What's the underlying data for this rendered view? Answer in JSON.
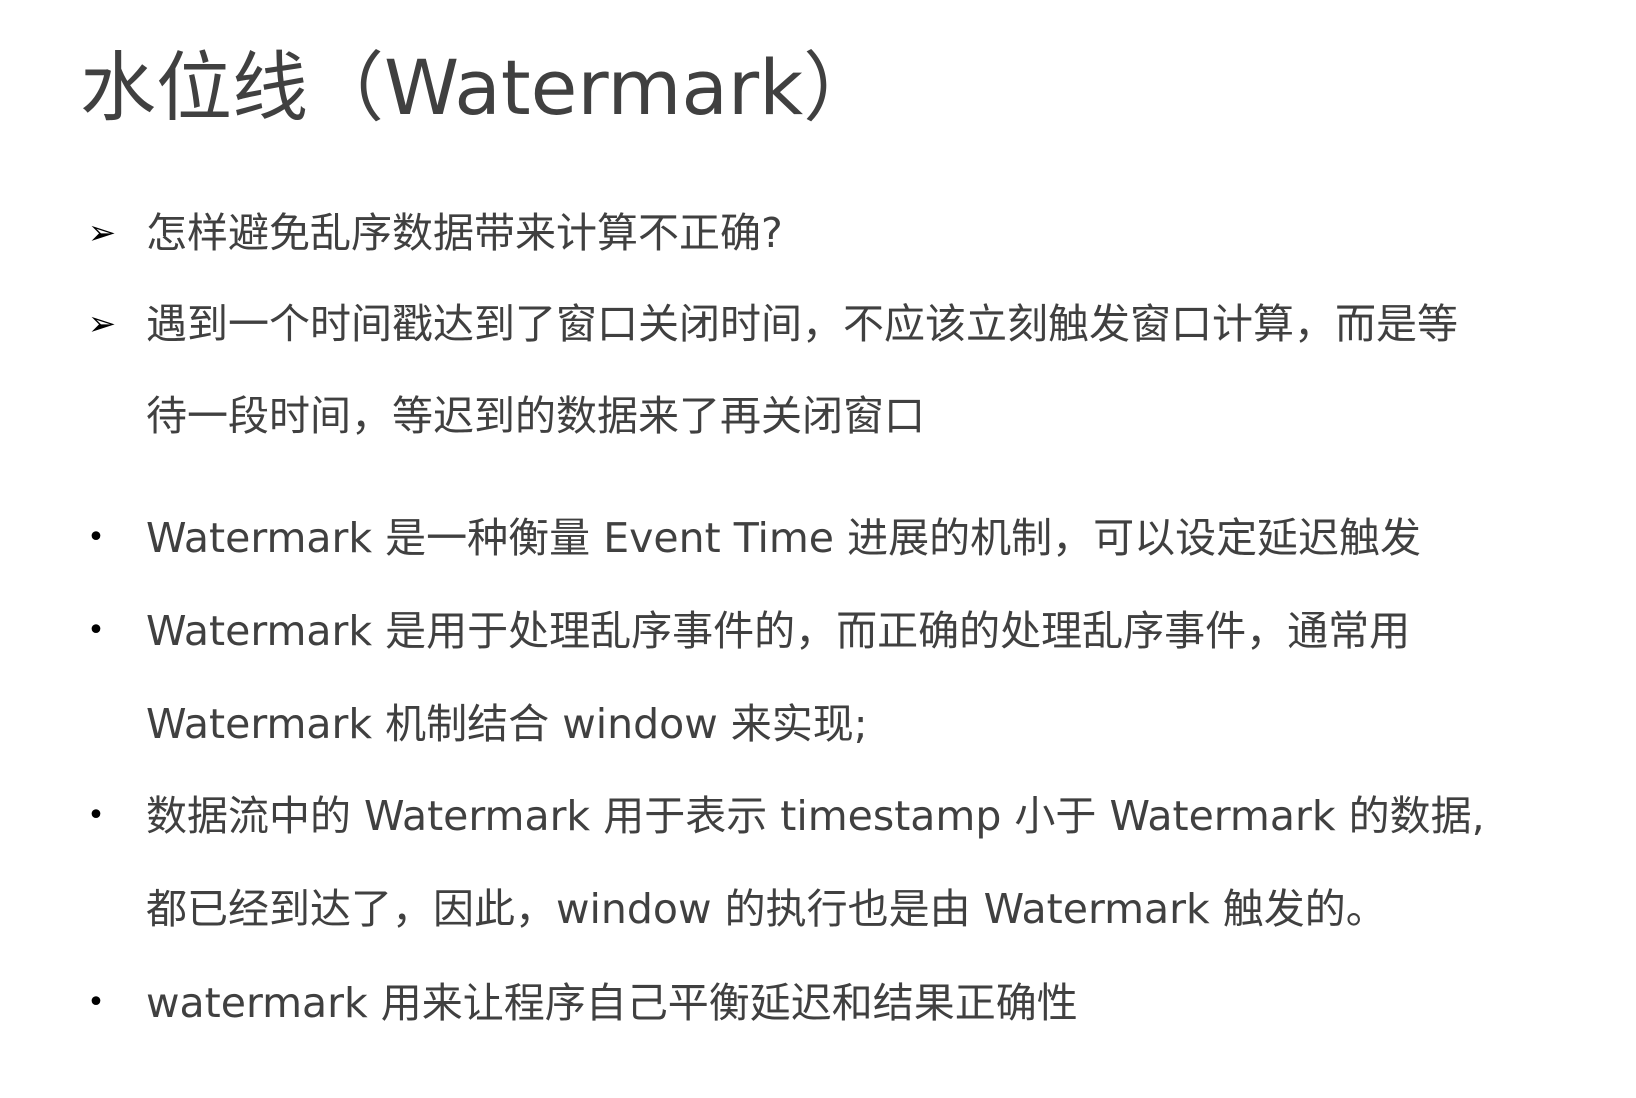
{
  "slide": {
    "title": "水位线（Watermark）",
    "items": [
      {
        "marker": "arrow",
        "marker_glyph": "➢",
        "lines": [
          "怎样避免乱序数据带来计算不正确?"
        ]
      },
      {
        "marker": "arrow",
        "marker_glyph": "➢",
        "lines": [
          "遇到一个时间戳达到了窗口关闭时间，不应该立刻触发窗口计算，而是等",
          "待一段时间，等迟到的数据来了再关闭窗口"
        ]
      },
      {
        "marker": "dot",
        "marker_glyph": "•",
        "lines": [
          "Watermark 是一种衡量 Event Time 进展的机制，可以设定延迟触发"
        ]
      },
      {
        "marker": "dot",
        "marker_glyph": "•",
        "lines": [
          "Watermark 是用于处理乱序事件的，而正确的处理乱序事件，通常用",
          "Watermark 机制结合 window 来实现;"
        ]
      },
      {
        "marker": "dot",
        "marker_glyph": "•",
        "lines": [
          "数据流中的 Watermark 用于表示 timestamp 小于 Watermark 的数据,",
          "都已经到达了，因此，window 的执行也是由 Watermark 触发的。"
        ]
      },
      {
        "marker": "dot",
        "marker_glyph": "•",
        "lines": [
          "watermark 用来让程序自己平衡延迟和结果正确性"
        ]
      }
    ]
  },
  "colors": {
    "text": "#404040",
    "marker": "#000000",
    "background": "#ffffff"
  }
}
